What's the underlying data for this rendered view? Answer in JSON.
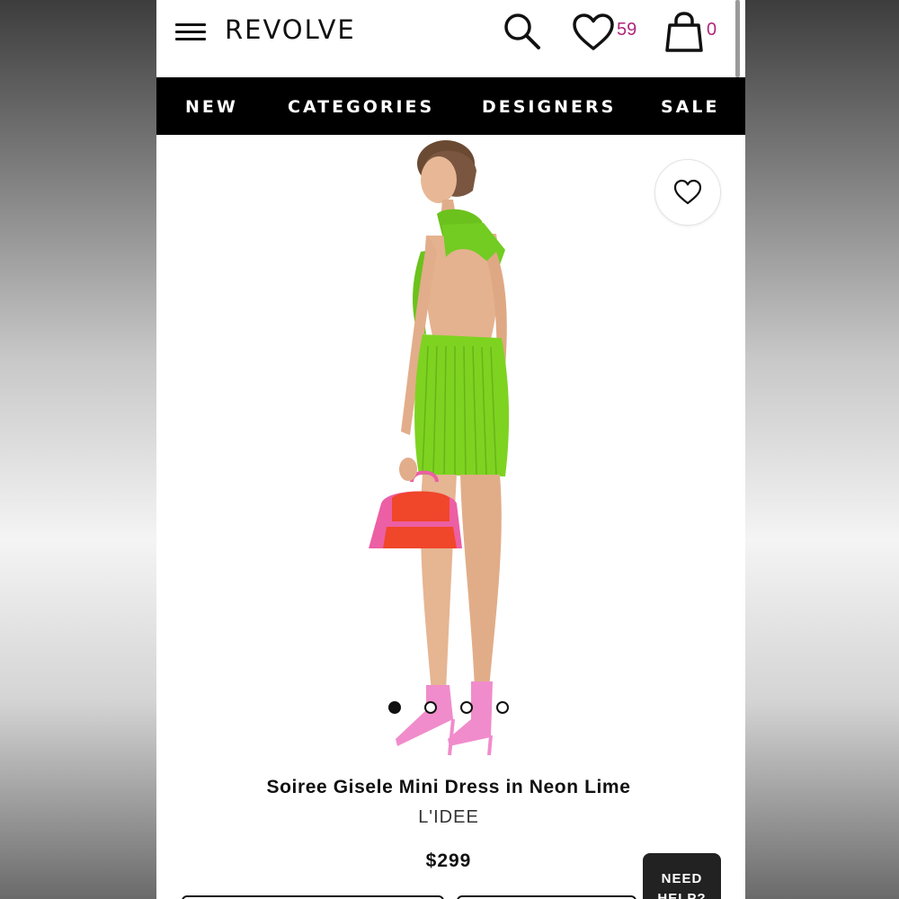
{
  "header": {
    "logo": "REVOLVE",
    "wishlist_count": "59",
    "bag_count": "0"
  },
  "nav": {
    "items": [
      "NEW",
      "CATEGORIES",
      "DESIGNERS",
      "SALE"
    ]
  },
  "gallery": {
    "total_images": 4,
    "active_index": 0
  },
  "product": {
    "title": "Soiree Gisele Mini Dress in Neon Lime",
    "brand": "L'IDEE",
    "price": "$299"
  },
  "help": {
    "label": "NEED HELP?"
  },
  "colors": {
    "accent_count": "#b0257a",
    "dress": "#7ed321",
    "bag_orange": "#f0462a",
    "bag_pink": "#ec5fa4"
  }
}
